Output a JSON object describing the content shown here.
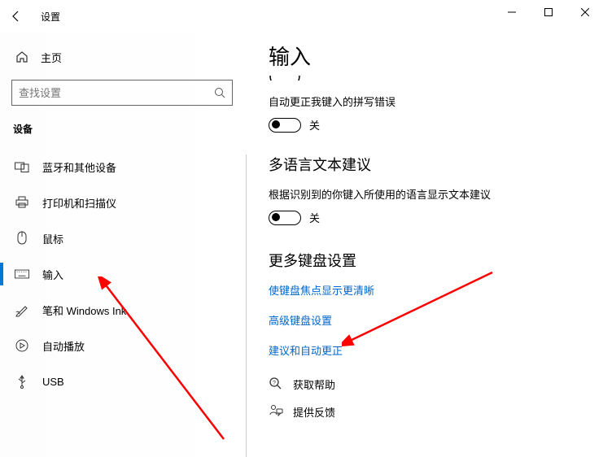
{
  "window": {
    "title": "设置"
  },
  "sidebar": {
    "home": "主页",
    "search_placeholder": "查找设置",
    "category": "设备",
    "items": [
      {
        "label": "蓝牙和其他设备"
      },
      {
        "label": "打印机和扫描仪"
      },
      {
        "label": "鼠标"
      },
      {
        "label": "输入"
      },
      {
        "label": "笔和 Windows Ink"
      },
      {
        "label": "自动播放"
      },
      {
        "label": "USB"
      }
    ]
  },
  "main": {
    "title": "输入",
    "setting1": {
      "label": "自动更正我键入的拼写错误",
      "state": "关"
    },
    "section2": {
      "heading": "多语言文本建议",
      "label": "根据识别到的你键入所使用的语言显示文本建议",
      "state": "关"
    },
    "section3": {
      "heading": "更多键盘设置",
      "links": {
        "l1": "使键盘焦点显示更清晰",
        "l2": "高级键盘设置",
        "l3": "建议和自动更正"
      }
    },
    "help": {
      "get_help": "获取帮助",
      "feedback": "提供反馈"
    }
  }
}
